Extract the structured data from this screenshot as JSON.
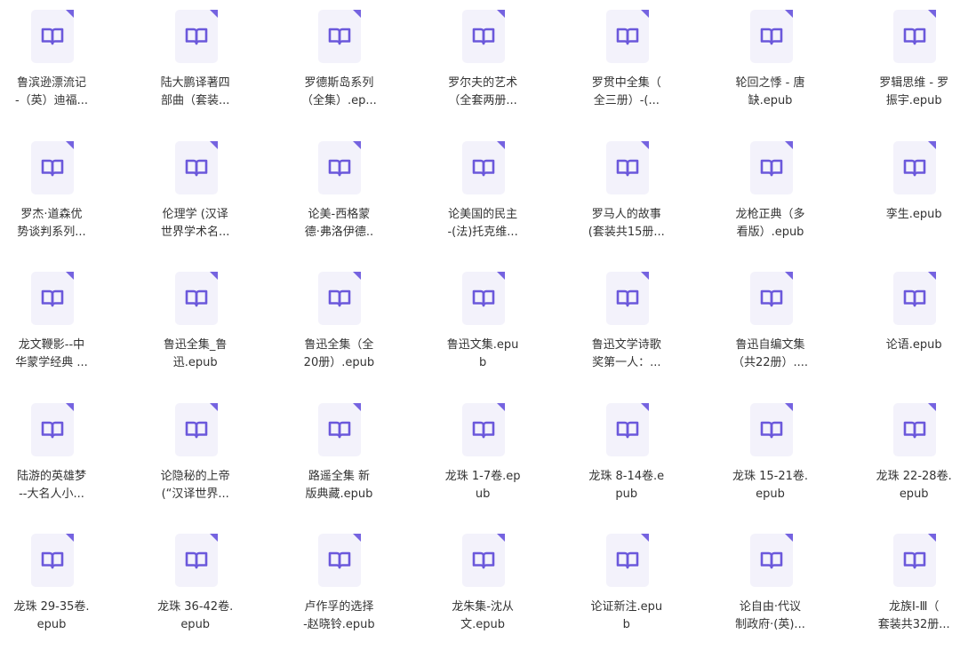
{
  "colors": {
    "page_background": "#ffffff",
    "icon_fill": "#f3f2fb",
    "icon_corner": "#7563e0",
    "icon_book": "#6b58db",
    "label_text": "#333333"
  },
  "icon_name": "ebook-file-icon",
  "files": [
    {
      "lines": [
        "鲁滨逊漂流记",
        "-（英）迪福..."
      ]
    },
    {
      "lines": [
        "陆大鹏译著四",
        "部曲（套装..."
      ]
    },
    {
      "lines": [
        "罗德斯岛系列",
        "（全集）.ep..."
      ]
    },
    {
      "lines": [
        "罗尔夫的艺术",
        "（全套两册..."
      ]
    },
    {
      "lines": [
        "罗贯中全集（",
        "全三册）-(..."
      ]
    },
    {
      "lines": [
        "轮回之悸 - 唐",
        "缺.epub"
      ]
    },
    {
      "lines": [
        "罗辑思维 - 罗",
        "振宇.epub"
      ]
    },
    {
      "lines": [
        "罗杰·道森优",
        "势谈判系列..."
      ]
    },
    {
      "lines": [
        "伦理学 (汉译",
        "世界学术名..."
      ]
    },
    {
      "lines": [
        "论美-西格蒙",
        "德·弗洛伊德.."
      ]
    },
    {
      "lines": [
        "论美国的民主",
        "-(法)托克维..."
      ]
    },
    {
      "lines": [
        "罗马人的故事",
        "(套装共15册..."
      ]
    },
    {
      "lines": [
        "龙枪正典（多",
        "看版）.epub"
      ]
    },
    {
      "lines": [
        "孪生.epub"
      ]
    },
    {
      "lines": [
        "龙文鞭影--中",
        "华蒙学经典 ..."
      ]
    },
    {
      "lines": [
        "鲁迅全集_鲁",
        "迅.epub"
      ]
    },
    {
      "lines": [
        "鲁迅全集（全",
        "20册）.epub"
      ]
    },
    {
      "lines": [
        "鲁迅文集.epu",
        "b"
      ]
    },
    {
      "lines": [
        "鲁迅文学诗歌",
        "奖第一人：..."
      ]
    },
    {
      "lines": [
        "鲁迅自编文集",
        "（共22册）...."
      ]
    },
    {
      "lines": [
        "论语.epub"
      ]
    },
    {
      "lines": [
        "陆游的英雄梦",
        "--大名人小..."
      ]
    },
    {
      "lines": [
        "论隐秘的上帝",
        "(“汉译世界..."
      ]
    },
    {
      "lines": [
        "路遥全集 新",
        "版典藏.epub"
      ]
    },
    {
      "lines": [
        "龙珠 1-7卷.ep",
        "ub"
      ]
    },
    {
      "lines": [
        "龙珠 8-14卷.e",
        "pub"
      ]
    },
    {
      "lines": [
        "龙珠 15-21卷.",
        "epub"
      ]
    },
    {
      "lines": [
        "龙珠 22-28卷.",
        "epub"
      ]
    },
    {
      "lines": [
        "龙珠 29-35卷.",
        "epub"
      ]
    },
    {
      "lines": [
        "龙珠 36-42卷.",
        "epub"
      ]
    },
    {
      "lines": [
        "卢作孚的选择",
        "-赵晓铃.epub"
      ]
    },
    {
      "lines": [
        "龙朱集-沈从",
        "文.epub"
      ]
    },
    {
      "lines": [
        "论证新注.epu",
        "b"
      ]
    },
    {
      "lines": [
        "论自由·代议",
        "制政府·(英)..."
      ]
    },
    {
      "lines": [
        "龙族Ⅰ-Ⅲ（",
        "套装共32册..."
      ]
    }
  ]
}
